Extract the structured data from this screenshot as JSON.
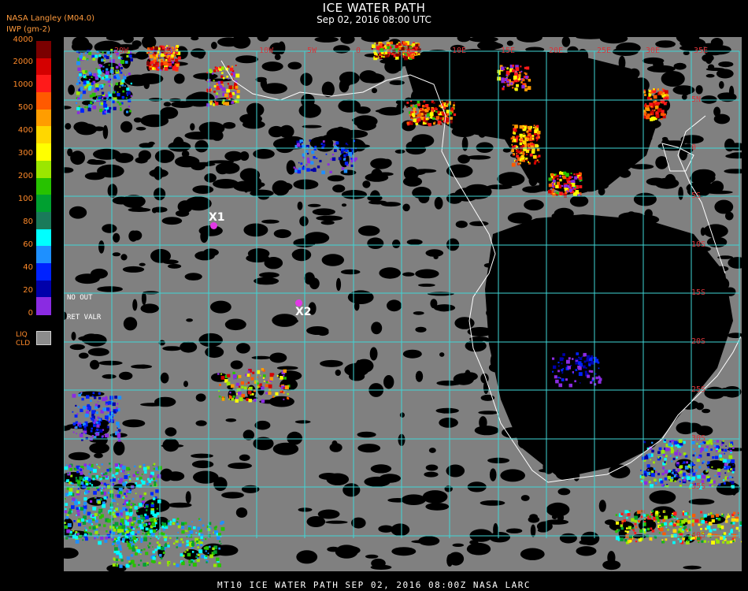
{
  "title": "ICE WATER PATH",
  "datetime": "Sep 02, 2016 08:00 UTC",
  "header": {
    "source": "NASA Langley (M04.0)",
    "units": "IWP (gm-2)"
  },
  "legend": {
    "ticks": [
      "4000",
      "2000",
      "1000",
      "500",
      "400",
      "300",
      "200",
      "100",
      "80",
      "60",
      "40",
      "20",
      "0"
    ],
    "colors": [
      "#7a0000",
      "#d40000",
      "#ff1a1a",
      "#ff5a00",
      "#ff9d00",
      "#ffd700",
      "#ffff00",
      "#9be600",
      "#27c200",
      "#00a030",
      "#1a7a5a",
      "#00ffff",
      "#1e90ff",
      "#0022ff",
      "#0000aa",
      "#8a2be2"
    ],
    "liq_cld_label": "LIQ\nCLD",
    "liq_cld_color": "#8c8c8c"
  },
  "grid": {
    "lon_labels": [
      "20W",
      "15W",
      "10W",
      "5W",
      "0",
      "5E",
      "10E",
      "15E",
      "20E",
      "25E",
      "30E",
      "35E"
    ],
    "lat_labels": [
      "5N",
      "0",
      "5S",
      "10S",
      "15S",
      "20S",
      "25S",
      "30S",
      "35S",
      "40S"
    ]
  },
  "annotations": {
    "no_out": "NO   OUT",
    "ret_valr": "RET  VALR"
  },
  "markers": [
    {
      "label": "X1"
    },
    {
      "label": "X2"
    }
  ],
  "footer": "MT10  ICE WATER PATH   SEP 02, 2016 08:00Z   NASA LARC"
}
